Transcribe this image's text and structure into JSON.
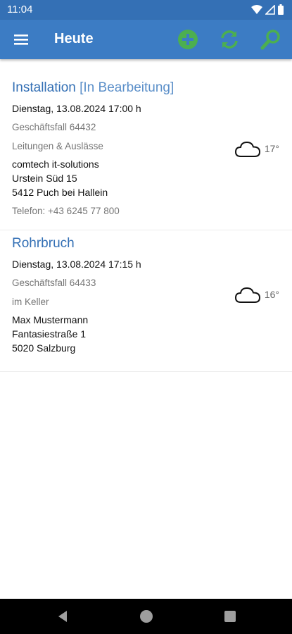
{
  "status_bar": {
    "time": "11:04",
    "icons": [
      "wifi-icon",
      "signal-icon",
      "battery-icon"
    ]
  },
  "app_bar": {
    "title": "Heute",
    "actions": [
      "add-icon",
      "sync-icon",
      "search-icon"
    ],
    "background": "#3c7cc4",
    "action_color": "#4caf50"
  },
  "appointments": [
    {
      "title": "Installation",
      "status": "[In Bearbeitung]",
      "datetime": "Dienstag, 13.08.2024  17:00 h",
      "case": "Geschäftsfall 64432",
      "description": "Leitungen & Auslässe",
      "address": [
        "comtech it-solutions",
        "Urstein Süd 15",
        "5412 Puch bei Hallein"
      ],
      "phone": "Telefon: +43 6245 77 800",
      "weather": {
        "icon": "cloud-icon",
        "temperature": "17°"
      }
    },
    {
      "title": "Rohrbruch",
      "status": "",
      "datetime": "Dienstag, 13.08.2024  17:15 h",
      "case": "Geschäftsfall 64433",
      "description": "im Keller",
      "address": [
        "Max Mustermann",
        "Fantasiestraße 1",
        "5020 Salzburg"
      ],
      "phone": "",
      "weather": {
        "icon": "cloud-icon",
        "temperature": "16°"
      }
    }
  ],
  "nav_bar": {
    "buttons": [
      "back-icon",
      "home-icon",
      "recents-icon"
    ]
  }
}
